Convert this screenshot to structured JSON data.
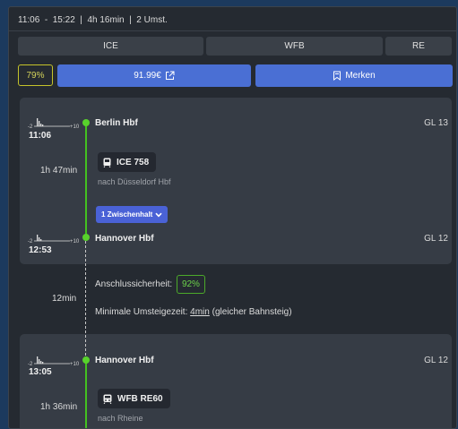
{
  "header": {
    "summary": "11:06  -  15:22  |  4h 16min  |  2 Umst."
  },
  "trains_bar": [
    "ICE",
    "WFB",
    "RE"
  ],
  "actions": {
    "reliability": "79%",
    "price": "91.99€",
    "bookmark_label": "Merken"
  },
  "leg1": {
    "dep_station": "Berlin Hbf",
    "dep_time": "11:06",
    "dep_platform": "GL 13",
    "duration": "1h 47min",
    "train": "ICE 758",
    "destination": "nach Düsseldorf Hbf",
    "stops_button": "1 Zwischenhalt",
    "arr_station": "Hannover Hbf",
    "arr_time": "12:53",
    "arr_platform": "GL 12"
  },
  "transfer": {
    "duration": "12min",
    "safety_label": "Anschlussicherheit:",
    "safety_value": "92%",
    "min_change_label": "Minimale Umsteigezeit:",
    "min_change_value": "4min",
    "min_change_note": "(gleicher Bahnsteig)"
  },
  "leg2": {
    "dep_station": "Hannover Hbf",
    "dep_time": "13:05",
    "dep_platform": "GL 12",
    "duration": "1h 36min",
    "train": "WFB RE60",
    "destination": "nach Rheine"
  },
  "delay_scale": {
    "min": "-2",
    "max": "+10"
  },
  "colors": {
    "accent_blue": "#4a6fd4",
    "route_green": "#44c020",
    "reliability_yellow": "#c5c42a",
    "safety_green": "#4caa2a"
  }
}
